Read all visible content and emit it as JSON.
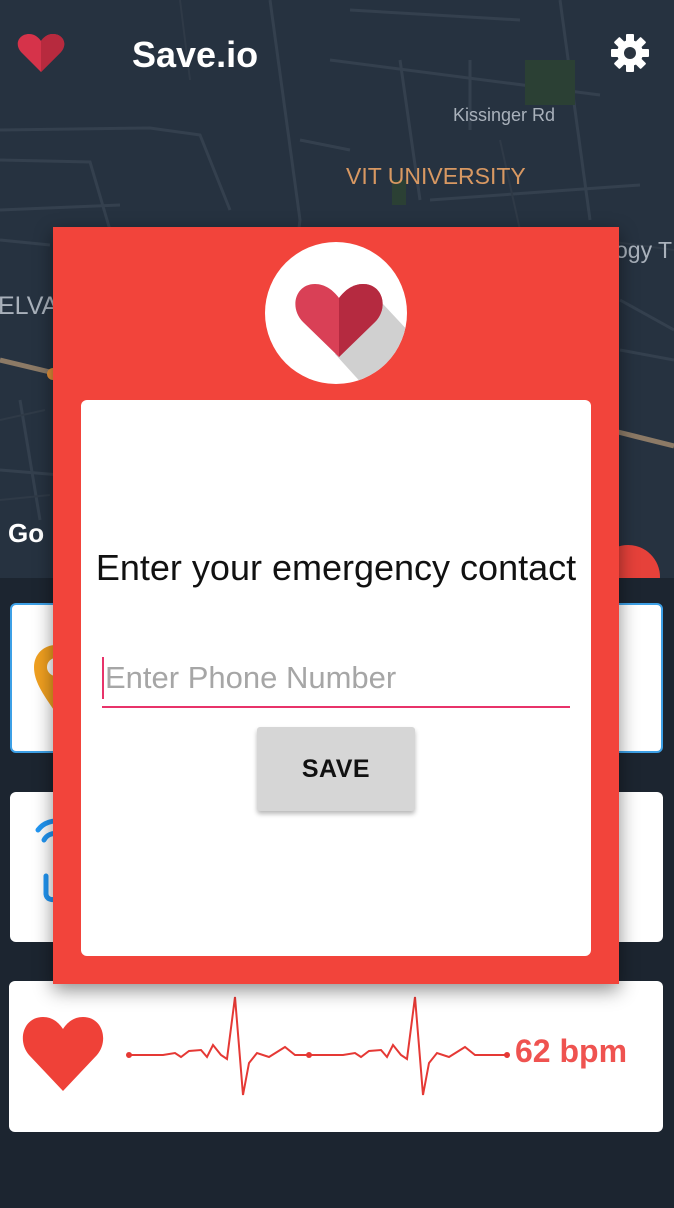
{
  "app_bar": {
    "title": "Save.io",
    "logo_icon": "heart-icon",
    "settings_icon": "gear-icon"
  },
  "map": {
    "labels": {
      "kissinger": "Kissinger Rd",
      "university": "VIT UNIVERSITY",
      "technology": "ogy T",
      "elva": "ELVA"
    },
    "attribution": "Go"
  },
  "dialog": {
    "icon": "heart-icon",
    "prompt": "Enter your emergency contact",
    "phone_input": {
      "value": "",
      "placeholder": "Enter Phone Number"
    },
    "save_label": "SAVE"
  },
  "cards": {
    "heart_rate": {
      "value": "62 bpm",
      "icon": "heart-icon"
    },
    "location_icon": "location-pin-icon",
    "wifi_icon": "wifi-icon"
  },
  "colors": {
    "dialog_red": "#f2443b",
    "accent_pink": "#e8336a",
    "bpm_red": "#ef5350",
    "map_bg": "#263240"
  }
}
